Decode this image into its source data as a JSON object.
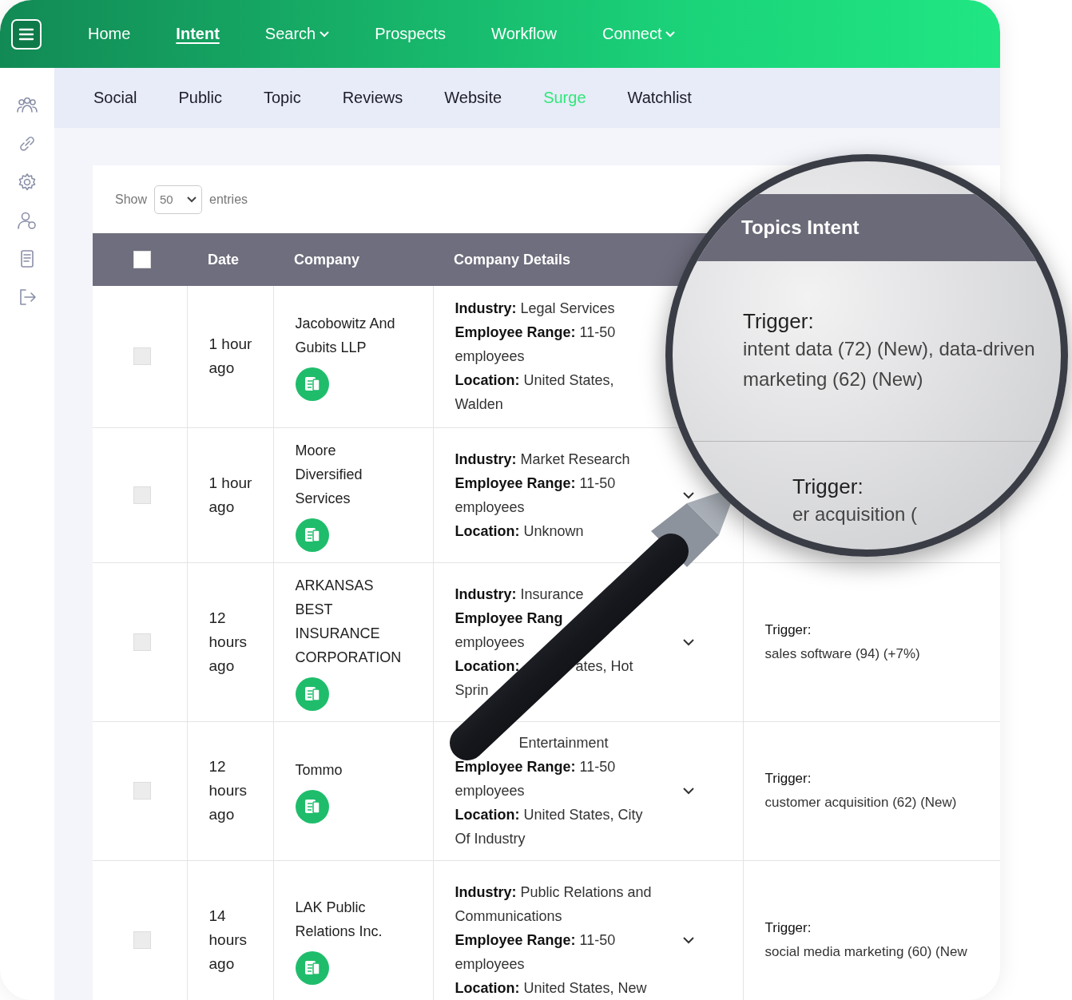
{
  "nav": {
    "items": [
      {
        "label": "Home",
        "selected": false,
        "dropdown": false
      },
      {
        "label": "Intent",
        "selected": true,
        "dropdown": false
      },
      {
        "label": "Search",
        "selected": false,
        "dropdown": true
      },
      {
        "label": "Prospects",
        "selected": false,
        "dropdown": false
      },
      {
        "label": "Workflow",
        "selected": false,
        "dropdown": false
      },
      {
        "label": "Connect",
        "selected": false,
        "dropdown": true
      }
    ]
  },
  "subnav": {
    "items": [
      {
        "label": "Social",
        "selected": false
      },
      {
        "label": "Public",
        "selected": false
      },
      {
        "label": "Topic",
        "selected": false
      },
      {
        "label": "Reviews",
        "selected": false
      },
      {
        "label": "Website",
        "selected": false
      },
      {
        "label": "Surge",
        "selected": true
      },
      {
        "label": "Watchlist",
        "selected": false
      }
    ]
  },
  "show_entries": {
    "label": "Show",
    "value": "50",
    "suffix": "entries"
  },
  "table": {
    "select_all_checked": false,
    "columns": [
      {
        "label": "Date"
      },
      {
        "label": "Company"
      },
      {
        "label": "Company Details"
      }
    ],
    "rows": [
      {
        "checked": false,
        "date": "1 hour ago",
        "company": "Jacobowitz And Gubits LLP",
        "details": [
          [
            "**Industry:** Legal Services"
          ],
          [
            "**Employee Range:** 11-50"
          ],
          [
            "employees"
          ],
          [
            "**Location:** United States,"
          ],
          [
            "Walden"
          ]
        ]
      },
      {
        "checked": false,
        "date": "1 hour ago",
        "company": "Moore Diversified Services",
        "details": [
          [
            "**Industry:** Market Research"
          ],
          [
            "**Employee Range:** 11-50"
          ],
          [
            "employees"
          ],
          [
            "**Location:** Unknown"
          ]
        ]
      },
      {
        "checked": false,
        "date": "12 hours ago",
        "company": "ARKANSAS BEST INSURANCE CORPORATION",
        "details": [
          [
            "**Industry:** Insurance"
          ],
          [
            "**Employee Rang**"
          ],
          [
            "employees"
          ],
          [
            "**Location:**",
            "ates, Hot"
          ],
          [
            "Sprin"
          ]
        ],
        "trigger_label": "Trigger:",
        "trigger": "sales software (94) (+7%)"
      },
      {
        "checked": false,
        "date": "12 hours ago",
        "company": "Tommo",
        "details": [
          {
            "kind": "partly_hidden",
            "parts": [
              "Entertainment"
            ]
          },
          [
            "**Employee Range:** 11-50"
          ],
          [
            "employees"
          ],
          [
            "**Location:** United States, City"
          ],
          [
            "Of Industry"
          ]
        ],
        "trigger_label": "Trigger:",
        "trigger": "customer acquisition (62) (New)"
      },
      {
        "checked": false,
        "date": "14 hours ago",
        "company": "LAK Public Relations Inc.",
        "details": [
          [
            "**Industry:** Public Relations and"
          ],
          [
            "Communications"
          ],
          [
            "**Employee Range:** 11-50"
          ],
          [
            "employees"
          ],
          [
            "**Location:** United States, New"
          ]
        ],
        "trigger_label": "Trigger:",
        "trigger": "social media marketing (60) (New"
      }
    ]
  },
  "magnifier": {
    "header": "Topics Intent",
    "entries": [
      {
        "label": "Trigger:",
        "text": "intent data (72) (New), data-driven marketing (62) (New)"
      },
      {
        "label": "Trigger:",
        "text": "er acquisition ("
      }
    ]
  }
}
